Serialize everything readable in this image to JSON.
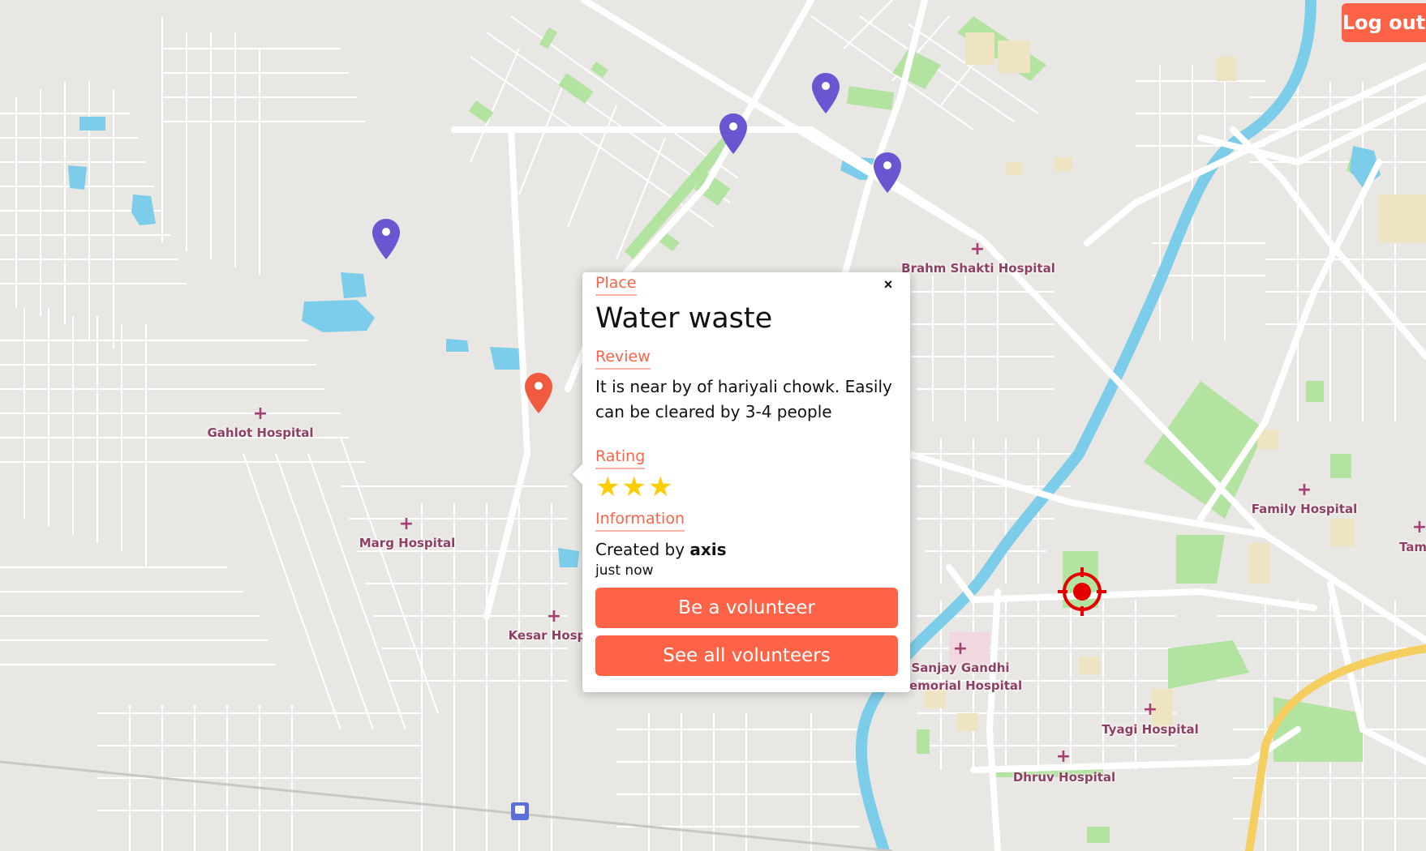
{
  "logout_label": "Log out",
  "popup": {
    "place_label": "Place",
    "title": "Water waste",
    "review_label": "Review",
    "review_text": "It is near by of hariyali chowk. Easily can be cleared by 3-4 people",
    "rating_label": "Rating",
    "rating": 3,
    "stars": "★★★",
    "information_label": "Information",
    "created_by_prefix": "Created by",
    "created_by_user": "axis",
    "created_time": "just now",
    "volunteer_button": "Be a volunteer",
    "see_volunteers_button": "See all volunteers",
    "close_symbol": "×"
  },
  "map_labels": {
    "brahm_shakti": "Brahm Shakti Hospital",
    "gahlot": "Gahlot Hospital",
    "marg": "Marg Hospital",
    "kesar": "Kesar Hospi",
    "family": "Family Hospital",
    "tam": "Tam",
    "sanjay_line1": "Sanjay Gandhi",
    "sanjay_line2": "lemorial Hospital",
    "tyagi": "Tyagi Hospital",
    "dhruv": "Dhruv Hospital"
  },
  "colors": {
    "accent": "#fe6347",
    "pin_purple": "#6c55d0",
    "pin_orange": "#f05b3f",
    "star": "#fecc02",
    "water": "#7ccde9",
    "park": "#b3e3a1",
    "highway": "#f4cf60",
    "target": "#e50000"
  },
  "icons": {
    "location_pins": "map-pin-icon",
    "current_location": "crosshair-target-icon",
    "hospital": "hospital-cross-icon",
    "station": "train-station-icon"
  }
}
